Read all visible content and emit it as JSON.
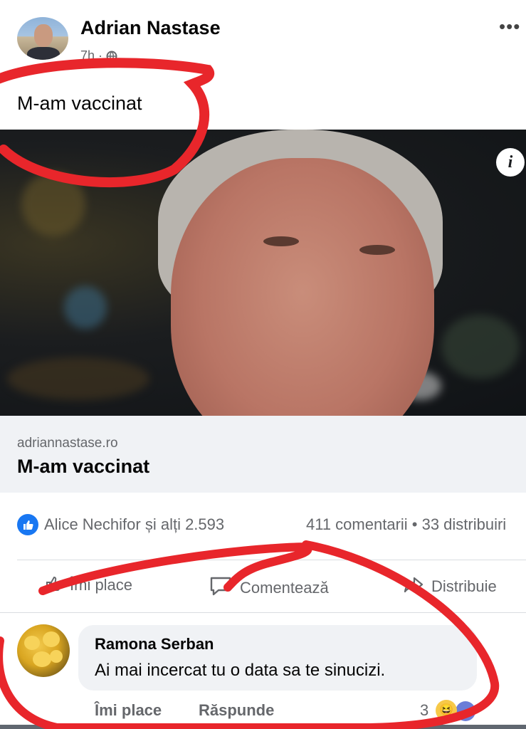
{
  "post": {
    "author": "Adrian Nastase",
    "timestamp": "7h",
    "audience_icon": "globe-icon",
    "more_icon": "more-options-icon",
    "more_label": "•••",
    "text": "M-am vaccinat"
  },
  "link_preview": {
    "info_label": "i",
    "domain": "adriannastase.ro",
    "title": "M-am vaccinat"
  },
  "stats": {
    "reactions": "Alice Nechifor și alți 2.593",
    "comments_shares": "411 comentarii • 33 distribuiri"
  },
  "actions": {
    "like": "Îmi place",
    "comment": "Comentează",
    "share": "Distribuie"
  },
  "comment": {
    "author": "Ramona Serban",
    "text": "Ai mai incercat tu o data sa te sinucizi.",
    "like_label": "Îmi place",
    "reply_label": "Răspunde",
    "reaction_count": "3"
  },
  "colors": {
    "annotation_red": "#e8262b",
    "facebook_blue": "#1877f2",
    "secondary_text": "#65676b"
  }
}
